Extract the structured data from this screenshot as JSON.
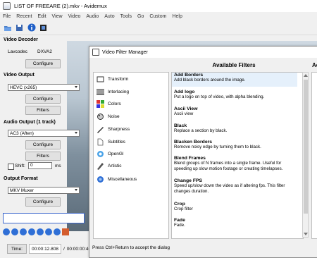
{
  "window": {
    "title": "LIST OF FREEARE (2).mkv - Avidemux"
  },
  "menu": [
    "File",
    "Recent",
    "Edit",
    "View",
    "Video",
    "Audio",
    "Auto",
    "Tools",
    "Go",
    "Custom",
    "Help"
  ],
  "left": {
    "video_decoder": {
      "label": "Video Decoder",
      "codec_key": "Lavcodec",
      "codec_value": "DXVA2",
      "configure": "Configure"
    },
    "video_output": {
      "label": "Video Output",
      "selected": "HEVC (x265)",
      "configure": "Configure",
      "filters": "Filters"
    },
    "audio_output": {
      "label": "Audio Output (1 track)",
      "selected": "AC3 (Aften)",
      "configure": "Configure",
      "filters": "Filters",
      "shift_label": "Shift:",
      "shift_value": "0",
      "shift_unit": "ms"
    },
    "output_format": {
      "label": "Output Format",
      "selected": "MKV Muxer",
      "configure": "Configure"
    }
  },
  "timebar": {
    "button": "Time:",
    "current": "00:00:12.808",
    "separator": "/",
    "total": "00:00:00:46"
  },
  "dialog": {
    "title": "Video Filter Manager",
    "available_heading": "Available Filters",
    "active_heading": "Ac",
    "status": "Press Ctrl+Return to accept the dialog",
    "categories": [
      {
        "label": "Transform",
        "icon": "transform-icon"
      },
      {
        "label": "Interlacing",
        "icon": "interlacing-icon"
      },
      {
        "label": "Colors",
        "icon": "colors-icon"
      },
      {
        "label": "Noise",
        "icon": "noise-icon"
      },
      {
        "label": "Sharpness",
        "icon": "sharpness-icon"
      },
      {
        "label": "Subtitles",
        "icon": "subtitles-icon"
      },
      {
        "label": "OpenGl",
        "icon": "opengl-icon"
      },
      {
        "label": "Artistic",
        "icon": "artistic-icon"
      },
      {
        "label": "Miscellaneous",
        "icon": "miscellaneous-icon"
      }
    ],
    "filters": [
      {
        "name": "Add Borders",
        "desc": "Add black borders around the image."
      },
      {
        "name": "Add logo",
        "desc": "Put a logo on top of video, with alpha blending."
      },
      {
        "name": "Ascii View",
        "desc": "Ascii view"
      },
      {
        "name": "Black",
        "desc": "Replace a section by black."
      },
      {
        "name": "Blacken Borders",
        "desc": "Remove noisy edge by turning them to black."
      },
      {
        "name": "Blend Frames",
        "desc": "Blend groups of N frames into a single frame.  Useful for speeding up slow motion footage or creating timelapses."
      },
      {
        "name": "Change FPS",
        "desc": "Speed up/slow down the video as if altering fps. This filter changes duration."
      },
      {
        "name": "Crop",
        "desc": "Crop filter"
      },
      {
        "name": "Fade",
        "desc": "Fade."
      }
    ]
  },
  "colors": {
    "accent": "#2f6fd6",
    "selected_row": "#e5f0fb",
    "record": "#d45d2e"
  }
}
